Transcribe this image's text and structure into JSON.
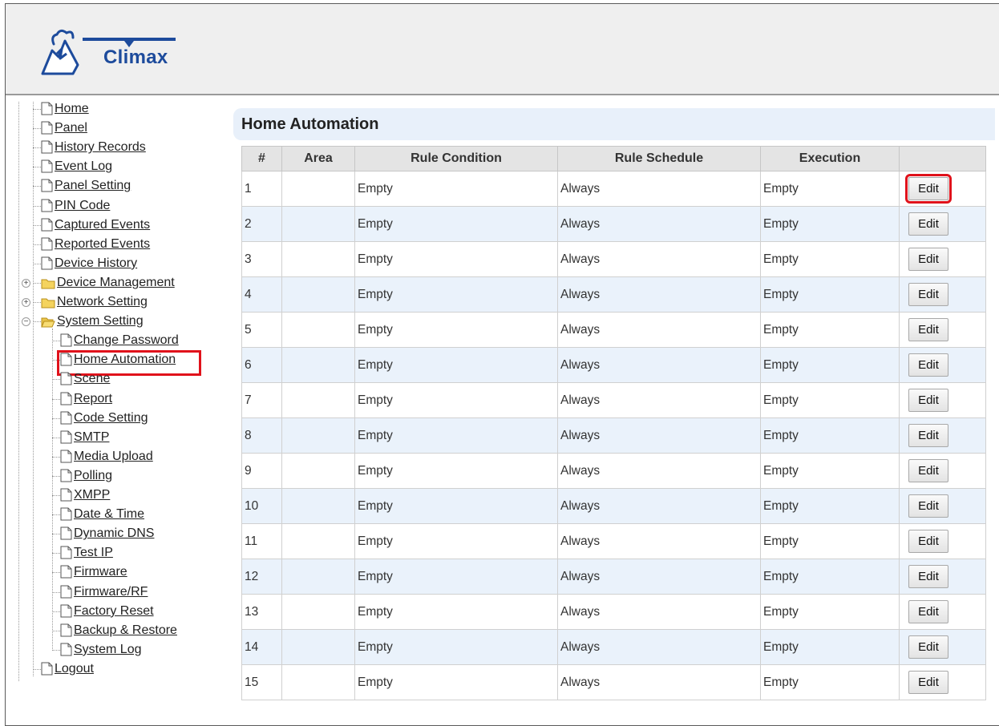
{
  "app": {
    "logo_text": "Climax"
  },
  "nav": {
    "items": [
      {
        "label": "Home",
        "type": "page",
        "indent": 0
      },
      {
        "label": "Panel",
        "type": "page",
        "indent": 0
      },
      {
        "label": "History Records",
        "type": "page",
        "indent": 0
      },
      {
        "label": "Event Log",
        "type": "page",
        "indent": 0
      },
      {
        "label": "Panel Setting",
        "type": "page",
        "indent": 0
      },
      {
        "label": "PIN Code",
        "type": "page",
        "indent": 0
      },
      {
        "label": "Captured Events",
        "type": "page",
        "indent": 0
      },
      {
        "label": "Reported Events",
        "type": "page",
        "indent": 0
      },
      {
        "label": "Device History",
        "type": "page",
        "indent": 0
      },
      {
        "label": "Device Management",
        "type": "folder",
        "indent": 0,
        "expander": "+"
      },
      {
        "label": "Network Setting",
        "type": "folder",
        "indent": 0,
        "expander": "+"
      },
      {
        "label": "System Setting",
        "type": "folder-open",
        "indent": 0,
        "expander": "−"
      },
      {
        "label": "Change Password",
        "type": "page",
        "indent": 1
      },
      {
        "label": "Home Automation",
        "type": "page",
        "indent": 1,
        "selected": true
      },
      {
        "label": "Scene",
        "type": "page",
        "indent": 1
      },
      {
        "label": "Report",
        "type": "page",
        "indent": 1
      },
      {
        "label": "Code Setting",
        "type": "page",
        "indent": 1
      },
      {
        "label": "SMTP",
        "type": "page",
        "indent": 1
      },
      {
        "label": "Media Upload",
        "type": "page",
        "indent": 1
      },
      {
        "label": "Polling",
        "type": "page",
        "indent": 1
      },
      {
        "label": "XMPP",
        "type": "page",
        "indent": 1
      },
      {
        "label": "Date & Time",
        "type": "page",
        "indent": 1
      },
      {
        "label": "Dynamic DNS",
        "type": "page",
        "indent": 1
      },
      {
        "label": "Test IP",
        "type": "page",
        "indent": 1
      },
      {
        "label": "Firmware",
        "type": "page",
        "indent": 1
      },
      {
        "label": "Firmware/RF",
        "type": "page",
        "indent": 1
      },
      {
        "label": "Factory Reset",
        "type": "page",
        "indent": 1
      },
      {
        "label": "Backup & Restore",
        "type": "page",
        "indent": 1
      },
      {
        "label": "System Log",
        "type": "page",
        "indent": 1
      },
      {
        "label": "Logout",
        "type": "page",
        "indent": 0
      }
    ]
  },
  "main": {
    "title": "Home Automation",
    "table": {
      "headers": [
        "#",
        "Area",
        "Rule Condition",
        "Rule Schedule",
        "Execution",
        ""
      ],
      "rows": [
        {
          "num": "1",
          "area": "",
          "condition": "Empty",
          "schedule": "Always",
          "execution": "Empty",
          "action": "Edit"
        },
        {
          "num": "2",
          "area": "",
          "condition": "Empty",
          "schedule": "Always",
          "execution": "Empty",
          "action": "Edit"
        },
        {
          "num": "3",
          "area": "",
          "condition": "Empty",
          "schedule": "Always",
          "execution": "Empty",
          "action": "Edit"
        },
        {
          "num": "4",
          "area": "",
          "condition": "Empty",
          "schedule": "Always",
          "execution": "Empty",
          "action": "Edit"
        },
        {
          "num": "5",
          "area": "",
          "condition": "Empty",
          "schedule": "Always",
          "execution": "Empty",
          "action": "Edit"
        },
        {
          "num": "6",
          "area": "",
          "condition": "Empty",
          "schedule": "Always",
          "execution": "Empty",
          "action": "Edit"
        },
        {
          "num": "7",
          "area": "",
          "condition": "Empty",
          "schedule": "Always",
          "execution": "Empty",
          "action": "Edit"
        },
        {
          "num": "8",
          "area": "",
          "condition": "Empty",
          "schedule": "Always",
          "execution": "Empty",
          "action": "Edit"
        },
        {
          "num": "9",
          "area": "",
          "condition": "Empty",
          "schedule": "Always",
          "execution": "Empty",
          "action": "Edit"
        },
        {
          "num": "10",
          "area": "",
          "condition": "Empty",
          "schedule": "Always",
          "execution": "Empty",
          "action": "Edit"
        },
        {
          "num": "11",
          "area": "",
          "condition": "Empty",
          "schedule": "Always",
          "execution": "Empty",
          "action": "Edit"
        },
        {
          "num": "12",
          "area": "",
          "condition": "Empty",
          "schedule": "Always",
          "execution": "Empty",
          "action": "Edit"
        },
        {
          "num": "13",
          "area": "",
          "condition": "Empty",
          "schedule": "Always",
          "execution": "Empty",
          "action": "Edit"
        },
        {
          "num": "14",
          "area": "",
          "condition": "Empty",
          "schedule": "Always",
          "execution": "Empty",
          "action": "Edit"
        },
        {
          "num": "15",
          "area": "",
          "condition": "Empty",
          "schedule": "Always",
          "execution": "Empty",
          "action": "Edit"
        }
      ]
    }
  },
  "colors": {
    "highlight": "#e0121b",
    "brand": "#1d4b9c",
    "row_alt": "#eaf2fb",
    "title_bg": "#e8f0fa"
  }
}
